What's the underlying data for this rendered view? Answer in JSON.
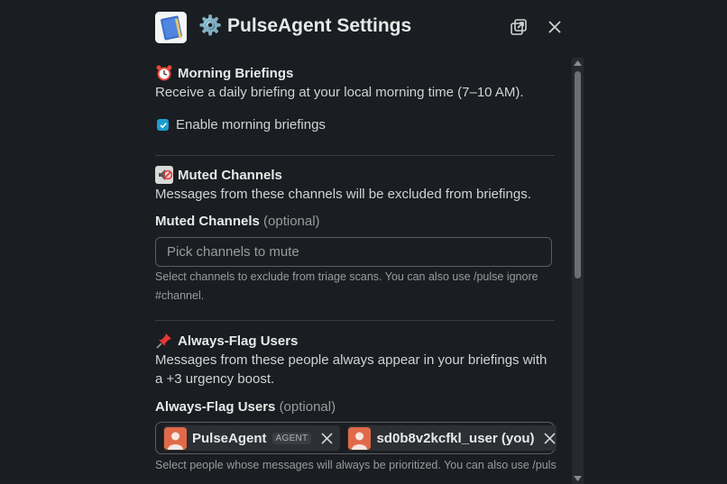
{
  "header": {
    "title": "⚙️ PulseAgent Settings",
    "app_icon": "notebook-icon",
    "popout_icon": "popout-icon",
    "close_icon": "close-icon"
  },
  "morning": {
    "emoji": "alarm-clock-icon",
    "title": "Morning Briefings",
    "desc": "Receive a daily briefing at your local morning time (7–10 AM).",
    "checkbox_label": "Enable morning briefings",
    "checked": true
  },
  "muted": {
    "emoji": "muted-speaker-icon",
    "title": "Muted Channels",
    "desc": "Messages from these channels will be excluded from briefings.",
    "field_label": "Muted Channels",
    "field_optional": "(optional)",
    "placeholder": "Pick channels to mute",
    "hint": "Select channels to exclude from triage scans. You can also use /pulse ignore #channel."
  },
  "flag": {
    "emoji": "pushpin-icon",
    "title": "Always-Flag Users",
    "desc": "Messages from these people always appear in your briefings with a +3 urgency boost.",
    "field_label": "Always-Flag Users",
    "field_optional": "(optional)",
    "chips": [
      {
        "name": "PulseAgent",
        "badge": "AGENT"
      },
      {
        "name": "sd0b8v2kcfkl_user (you)",
        "badge": ""
      }
    ],
    "hint": "Select people whose messages will always be prioritized. You can also use /pulse"
  },
  "colors": {
    "background": "#1a1d21",
    "checkbox": "#1d9bd1",
    "avatar": "#e0694a"
  }
}
